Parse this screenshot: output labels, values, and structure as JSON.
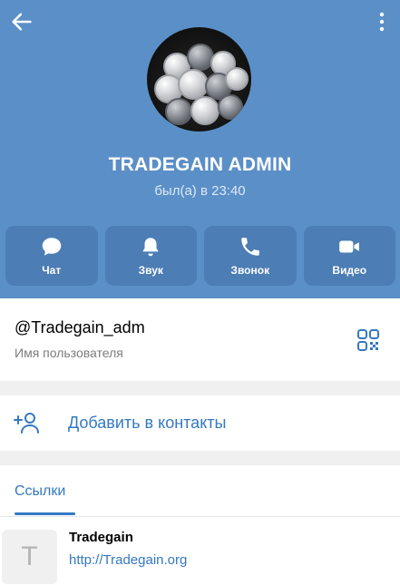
{
  "header": {
    "name": "TRADEGAIN ADMIN",
    "status": "был(а) в 23:40"
  },
  "actions": [
    {
      "label": "Чат",
      "icon": "chat-icon"
    },
    {
      "label": "Звук",
      "icon": "bell-icon"
    },
    {
      "label": "Звонок",
      "icon": "phone-icon"
    },
    {
      "label": "Видео",
      "icon": "video-icon"
    }
  ],
  "user_card": {
    "username": "@Tradegain_adm",
    "label": "Имя пользователя"
  },
  "add_contact": {
    "label": "Добавить в контакты"
  },
  "links": {
    "tab": "Ссылки",
    "item": {
      "thumb_letter": "T",
      "title": "Tradegain",
      "url": "http://Tradegain.org"
    }
  },
  "colors": {
    "header_bg": "#5b8fc7",
    "action_bg": "#4c7db4",
    "accent": "#3478c4"
  }
}
